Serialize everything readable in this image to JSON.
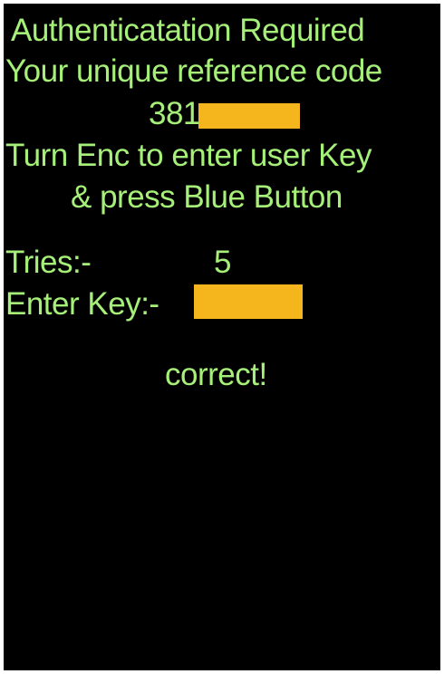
{
  "screen": {
    "title": "Authenticatation Required",
    "reference_label": "Your unique reference code",
    "reference_code_visible": "381",
    "instruction_line1": "Turn Enc to enter user Key",
    "instruction_line2": "& press Blue Button",
    "tries_label": "Tries:-",
    "tries_value": "5",
    "enter_key_label": "Enter Key:-",
    "result_message": "correct!"
  },
  "colors": {
    "background": "#000000",
    "text": "#a6f07a",
    "redaction": "#f5b51c"
  }
}
